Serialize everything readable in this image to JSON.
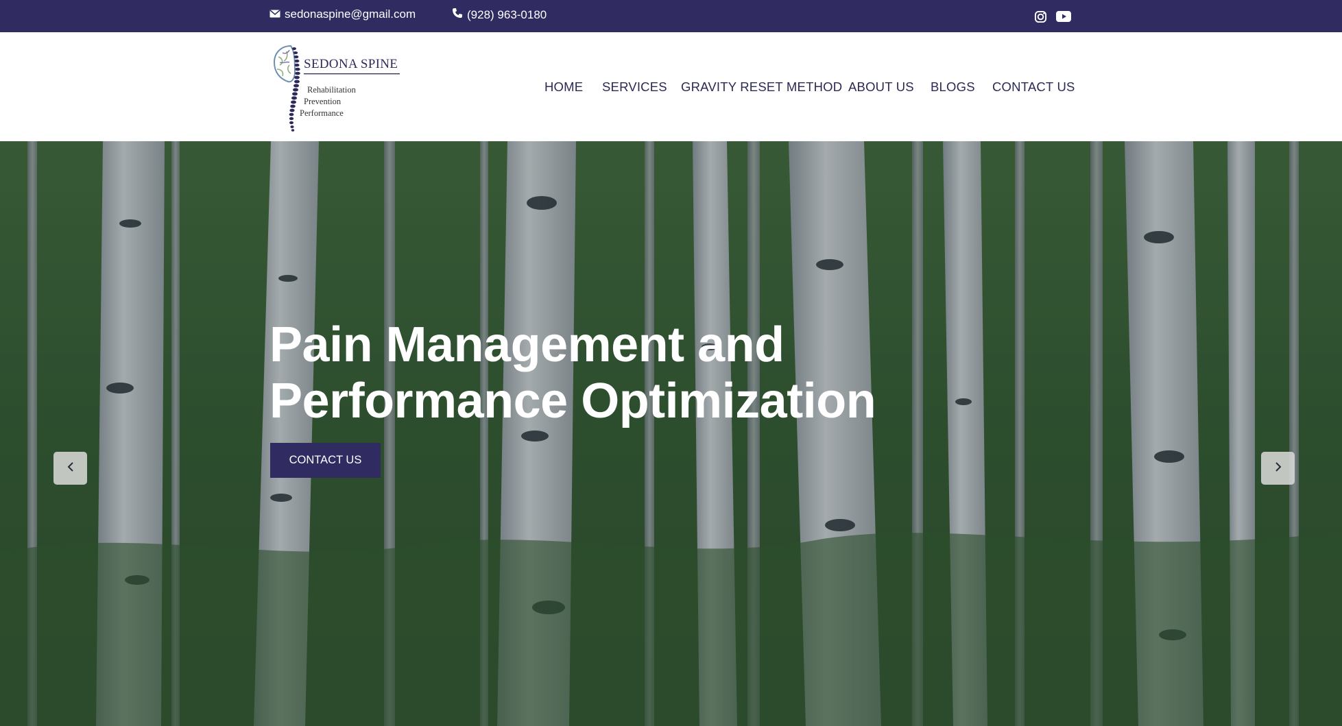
{
  "topbar": {
    "email": "sedonaspine@gmail.com",
    "phone": "(928) 963-0180",
    "social": [
      "instagram-icon",
      "youtube-icon"
    ]
  },
  "logo": {
    "brand": "SEDONA SPINE",
    "taglines": [
      "Rehabilitation",
      "Prevention",
      "Performance"
    ]
  },
  "nav": {
    "items": [
      "HOME",
      "SERVICES",
      "GRAVITY RESET METHOD",
      "ABOUT US",
      "BLOGS",
      "CONTACT US"
    ]
  },
  "hero": {
    "heading_line1": "Pain Management and",
    "heading_line2": "Performance Optimization",
    "cta_label": "CONTACT US"
  },
  "colors": {
    "primary": "#302c61",
    "white": "#ffffff",
    "nav_text": "#2b2a55"
  }
}
